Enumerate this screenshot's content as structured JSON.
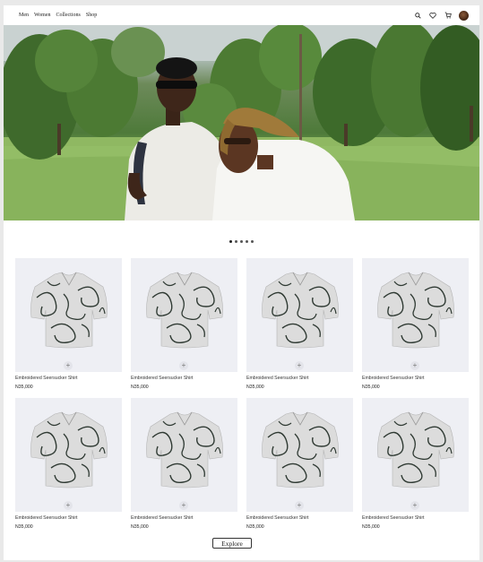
{
  "nav": {
    "items": [
      {
        "label": "Men"
      },
      {
        "label": "Women"
      },
      {
        "label": "Collections"
      },
      {
        "label": "Shop"
      }
    ]
  },
  "header": {
    "icons": [
      "search-icon",
      "heart-icon",
      "cart-icon",
      "avatar"
    ]
  },
  "hero": {
    "carousel_dots": 5,
    "active_dot": 1
  },
  "products": [
    {
      "name": "Embroidered Seersucker Shirt",
      "price": "N35,000"
    },
    {
      "name": "Embroidered Seersucker Shirt",
      "price": "N35,000"
    },
    {
      "name": "Embroidered Seersucker Shirt",
      "price": "N35,000"
    },
    {
      "name": "Embroidered Seersucker Shirt",
      "price": "N35,000"
    },
    {
      "name": "Embroidered Seersucker Shirt",
      "price": "N35,000"
    },
    {
      "name": "Embroidered Seersucker Shirt",
      "price": "N35,000"
    },
    {
      "name": "Embroidered Seersucker Shirt",
      "price": "N35,000"
    },
    {
      "name": "Embroidered Seersucker Shirt",
      "price": "N35,000"
    }
  ],
  "add_symbol": "+",
  "explore_label": "Explore",
  "colors": {
    "product_bg": "#eeeff4",
    "shirt": "#dcdcdc",
    "shirt_pattern": "#2f3a33"
  }
}
